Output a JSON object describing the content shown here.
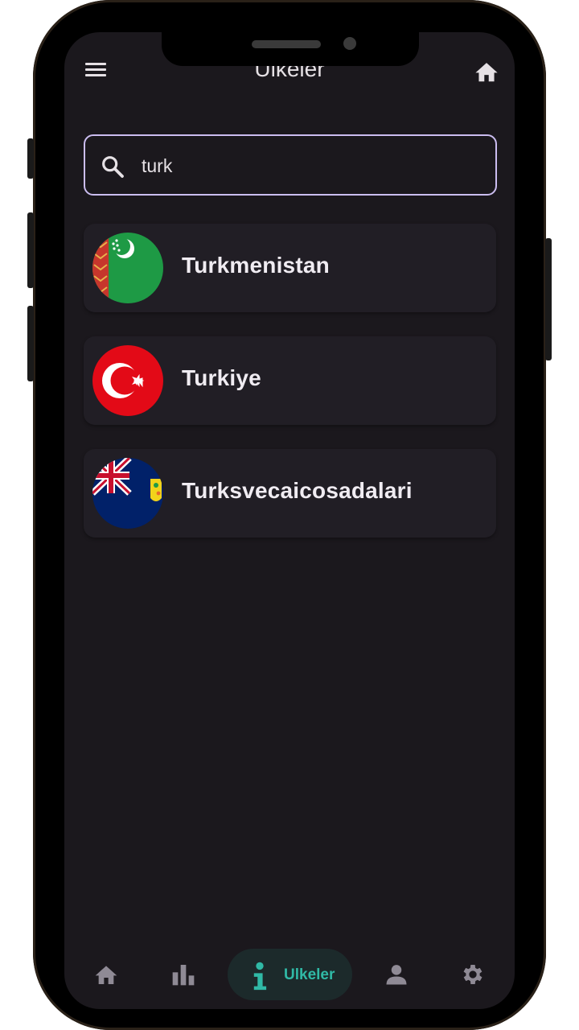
{
  "appbar": {
    "title": "Ulkeler",
    "menu_icon": "hamburger-menu-icon",
    "home_icon": "home-icon"
  },
  "search": {
    "value": "turk",
    "icon": "search-icon"
  },
  "countries": [
    {
      "name": "Turkmenistan",
      "flag": "turkmenistan-flag-icon"
    },
    {
      "name": "Turkiye",
      "flag": "turkiye-flag-icon"
    },
    {
      "name": "Turksvecaicosadalari",
      "flag": "turks-caicos-flag-icon"
    }
  ],
  "bottom_nav": {
    "items": [
      {
        "icon": "home-icon",
        "label": ""
      },
      {
        "icon": "bar-chart-icon",
        "label": ""
      },
      {
        "icon": "info-icon",
        "label": "Ulkeler",
        "selected": true
      },
      {
        "icon": "person-icon",
        "label": ""
      },
      {
        "icon": "gear-icon",
        "label": ""
      }
    ]
  },
  "colors": {
    "background": "#1b181d",
    "card": "#211e25",
    "search_border": "#cbbdf0",
    "accent": "#30b9a6",
    "text": "#e6e1e5"
  }
}
